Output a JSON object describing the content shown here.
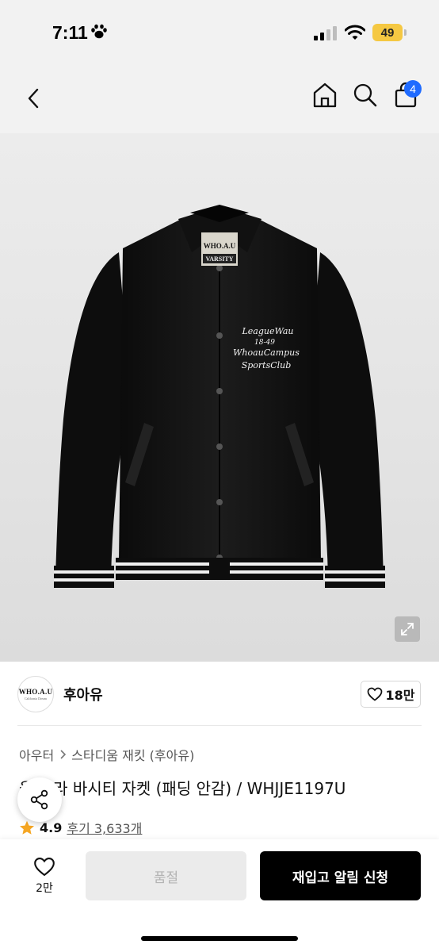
{
  "status_bar": {
    "time": "7:11",
    "battery": "49"
  },
  "nav": {
    "cart_badge": "4"
  },
  "hero": {
    "patch_text": [
      "LeagueWau",
      "18-49",
      "WhoauCampus",
      "SportsClub"
    ],
    "label_text": [
      "WHO.A.U",
      "VARSITY"
    ]
  },
  "brand": {
    "logo_text": "WHO.A.U",
    "logo_subtext": "California Dream",
    "name": "후아유",
    "likes": "18만"
  },
  "product": {
    "breadcrumb": [
      "아우터",
      "스타디움 재킷 (후아유)"
    ],
    "title": "울 카라 바시티 자켓 (패딩 안감) / WHJJE1197U",
    "rating": "4.9",
    "reviews": "후기 3,633개"
  },
  "bottom_bar": {
    "wish_count": "2만",
    "soldout_label": "품절",
    "restock_label": "재입고 알림 신청"
  },
  "colors": {
    "accent_blue": "#1f6bff",
    "star": "#f5a623",
    "battery": "#f5c842"
  }
}
